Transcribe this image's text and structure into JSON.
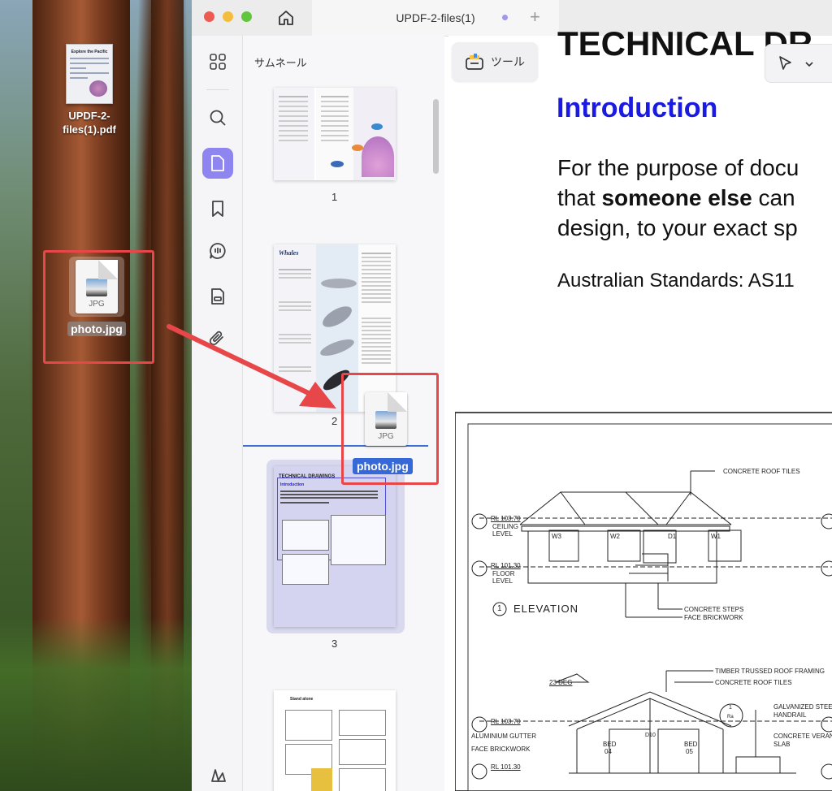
{
  "desktop": {
    "pdf_file_label": "UPDF-2-\nfiles(1).pdf",
    "pdf_file_label_line1": "UPDF-2-",
    "pdf_file_label_line2": "files(1).pdf",
    "pdf_thumb_title": "Explore the Pacific",
    "jpg_file_ext": "JPG",
    "jpg_file_name": "photo.jpg"
  },
  "window": {
    "tab_title": "UPDF-2-files(1)",
    "tab_plus": "+"
  },
  "thumbnail_panel": {
    "title": "サムネール",
    "pages": [
      {
        "number": "1"
      },
      {
        "number": "2",
        "heading": "Whales"
      },
      {
        "number": "3",
        "heading": "TECHNICAL DRAWINGS",
        "subheading": "Introduction"
      },
      {
        "number": "",
        "heading": "Stand alone"
      }
    ]
  },
  "drag_item": {
    "ext": "JPG",
    "name": "photo.jpg"
  },
  "toolbar": {
    "tool_label": "ツール"
  },
  "document": {
    "heading_main": "TECHNICAL DR",
    "heading_intro": "Introduction",
    "body_line1": "For the purpose of docu",
    "body_line2_bold": "someone else",
    "body_line2_pre": "that ",
    "body_line2_post": " can",
    "body_line3": "design, to your exact sp",
    "standards": "Australian Standards:  AS11",
    "drawing_labels": {
      "roof_tiles": "CONCRETE ROOF TILES",
      "rl_ceiling": "RL 103.70",
      "ceiling_level": "CEILING",
      "ceiling_level2": "LEVEL",
      "rl_floor": "RL 101.30",
      "floor_level": "FLOOR",
      "floor_level2": "LEVEL",
      "elevation_num": "1",
      "elevation": "ELEVATION",
      "steps": "CONCRETE STEPS",
      "brickwork": "FACE BRICKWORK",
      "w3": "W3",
      "w2": "W2",
      "w1": "W1",
      "d1": "D1",
      "timber": "TIMBER TRUSSED ROOF FRAMING",
      "roof_tiles2": "CONCRETE ROOF TILES",
      "deg": "23 DEG",
      "galv": "GALVANIZED STEEL",
      "handrail": "HANDRAIL",
      "rl_103": "RL 103.70",
      "gutter": "ALUMINIUM GUTTER",
      "veranda": "CONCRETE VERANDA",
      "slab": "SLAB",
      "brickwork2": "FACE BRICKWORK",
      "rl_101": "RL 101.30",
      "bed04": "BED",
      "bed04n": "04",
      "bed05": "BED",
      "bed05n": "05",
      "d10": "D10",
      "section_num": "1",
      "section_den": "Ra"
    }
  },
  "colors": {
    "accent": "#8f85f0",
    "annotation_red": "#e8474a",
    "intro_blue": "#1a1ae0",
    "drop_line": "#3b6fd4"
  }
}
